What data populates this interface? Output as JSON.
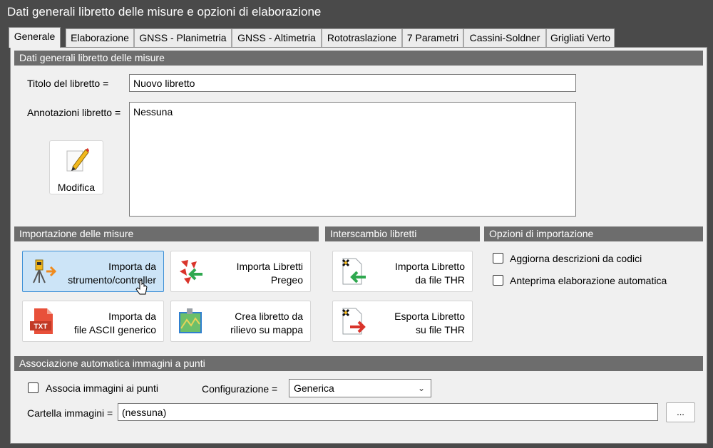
{
  "window": {
    "title": "Dati generali libretto delle misure e opzioni di elaborazione"
  },
  "tabs": [
    {
      "label": "Generale",
      "active": true
    },
    {
      "label": "Elaborazione"
    },
    {
      "label": "GNSS - Planimetria"
    },
    {
      "label": "GNSS - Altimetria"
    },
    {
      "label": "Rototraslazione"
    },
    {
      "label": "7 Parametri"
    },
    {
      "label": "Cassini-Soldner"
    },
    {
      "label": "Grigliati Verto"
    }
  ],
  "general": {
    "header": "Dati generali libretto delle misure",
    "title_label": "Titolo del libretto =",
    "title_value": "Nuovo libretto",
    "notes_label": "Annotazioni libretto =",
    "notes_value": "Nessuna",
    "modify_label": "Modifica"
  },
  "import": {
    "header": "Importazione delle misure",
    "from_instrument": [
      "Importa da",
      "strumento/controller"
    ],
    "pregeo": [
      "Importa Libretti",
      "Pregeo"
    ],
    "ascii": [
      "Importa da",
      "file ASCII generico"
    ],
    "from_map": [
      "Crea libretto da",
      "rilievo su mappa"
    ]
  },
  "exchange": {
    "header": "Interscambio libretti",
    "import_thr": [
      "Importa Libretto",
      "da file THR"
    ],
    "export_thr": [
      "Esporta Libretto",
      "su file THR"
    ]
  },
  "options": {
    "header": "Opzioni di importazione",
    "update_descriptions": {
      "label": "Aggiorna descrizioni da codici",
      "checked": false
    },
    "auto_preview": {
      "label": "Anteprima elaborazione automatica",
      "checked": false
    }
  },
  "images": {
    "header": "Associazione automatica immagini a punti",
    "associate": {
      "label": "Associa immagini ai punti",
      "checked": false
    },
    "config_label": "Configurazione =",
    "config_value": "Generica",
    "folder_label": "Cartella immagini =",
    "folder_value": "(nessuna)",
    "browse_label": "..."
  },
  "icons": {
    "txt_badge": "TXT",
    "accent": "#2f7fd0",
    "orange": "#f08a1c",
    "green": "#2fa84f",
    "red": "#d9342b"
  }
}
